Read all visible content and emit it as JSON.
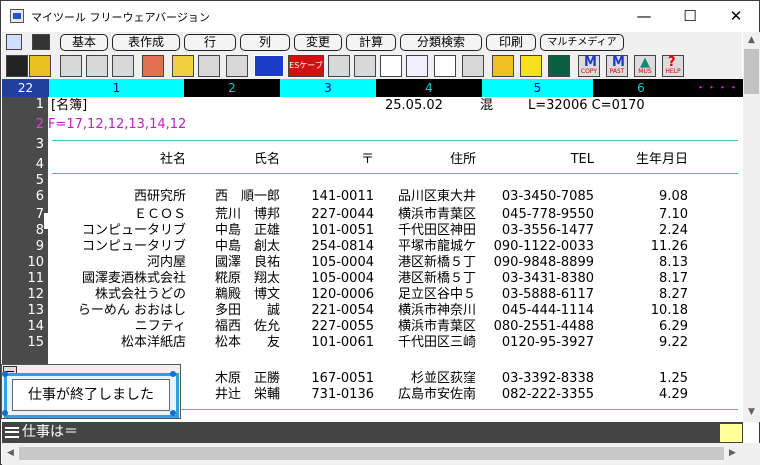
{
  "window": {
    "title": "マイツール フリーウェアバージョン",
    "min_label": "—",
    "max_label": "☐",
    "close_label": "✕"
  },
  "menu": [
    "基本",
    "表作成",
    "行",
    "列",
    "変更",
    "計算",
    "分類検索",
    "印刷",
    "マルチメディア"
  ],
  "toolbar": {
    "escape_label": "ESケーブ",
    "copy_label": "COPY",
    "paste_label": "PAST",
    "music_label": "MUS",
    "help_label": "HELP",
    "help_mark": "?"
  },
  "ruler": {
    "current": "22",
    "cols": [
      "1",
      "2",
      "3",
      "4",
      "5",
      "6"
    ],
    "tail": "・・・・+"
  },
  "gutter": [
    "1",
    "2",
    "3",
    "4",
    "5",
    "6",
    "7",
    "8",
    "9",
    "10",
    "11",
    "12",
    "13",
    "14",
    "15",
    "",
    "17"
  ],
  "file_row": {
    "name": "[名簿]",
    "date": "25.05.02",
    "mode": "混",
    "info": "L=32006 C=0170"
  },
  "format_row": "F=17,12,12,13,14,12",
  "columns": [
    "社名",
    "氏名",
    "〒",
    "住所",
    "TEL",
    "生年月日"
  ],
  "records": [
    {
      "company": "西研究所",
      "name": "西　順一郎",
      "zip": "141-0011",
      "addr": "品川区東大井",
      "tel": "03-3450-7085",
      "birth": "9.08"
    },
    {
      "company": "ＥＣＯＳ",
      "name": "荒川　博邦",
      "zip": "227-0044",
      "addr": "横浜市青葉区",
      "tel": "045-778-9550",
      "birth": "7.10"
    },
    {
      "company": "コンピュータリブ",
      "name": "中島　正雄",
      "zip": "101-0051",
      "addr": "千代田区神田",
      "tel": "03-3556-1477",
      "birth": "2.24"
    },
    {
      "company": "コンピュータリブ",
      "name": "中島　創太",
      "zip": "254-0814",
      "addr": "平塚市龍城ケ",
      "tel": "090-1122-0033",
      "birth": "11.26"
    },
    {
      "company": "河内屋",
      "name": "國澤　良祐",
      "zip": "105-0004",
      "addr": "港区新橋５丁",
      "tel": "090-9848-8899",
      "birth": "8.13"
    },
    {
      "company": "國澤麦酒株式会社",
      "name": "糀原　翔太",
      "zip": "105-0004",
      "addr": "港区新橋５丁",
      "tel": "03-3431-8380",
      "birth": "8.17"
    },
    {
      "company": "株式会社うどの",
      "name": "鵜殿　博文",
      "zip": "120-0006",
      "addr": "足立区谷中５",
      "tel": "03-5888-6117",
      "birth": "8.27"
    },
    {
      "company": "らーめん おおはし",
      "name": "多田　　誠",
      "zip": "221-0054",
      "addr": "横浜市神奈川",
      "tel": "045-444-1114",
      "birth": "10.18"
    },
    {
      "company": "ニフティ",
      "name": "福西　佐允",
      "zip": "227-0055",
      "addr": "横浜市青葉区",
      "tel": "080-2551-4488",
      "birth": "6.29"
    },
    {
      "company": "松本洋紙店",
      "name": "松本　　友",
      "zip": "101-0061",
      "addr": "千代田区三崎",
      "tel": "0120-95-3927",
      "birth": "9.22"
    },
    {
      "company": "",
      "name": "木原　正勝",
      "zip": "167-0051",
      "addr": "杉並区荻窪",
      "tel": "03-3392-8338",
      "birth": "1.25"
    },
    {
      "company": "",
      "name": "井辻　栄輔",
      "zip": "731-0136",
      "addr": "広島市安佐南",
      "tel": "082-222-3355",
      "birth": "4.29"
    }
  ],
  "dialog": {
    "message": "仕事が終了しました"
  },
  "status": {
    "prompt": "仕事は＝"
  }
}
